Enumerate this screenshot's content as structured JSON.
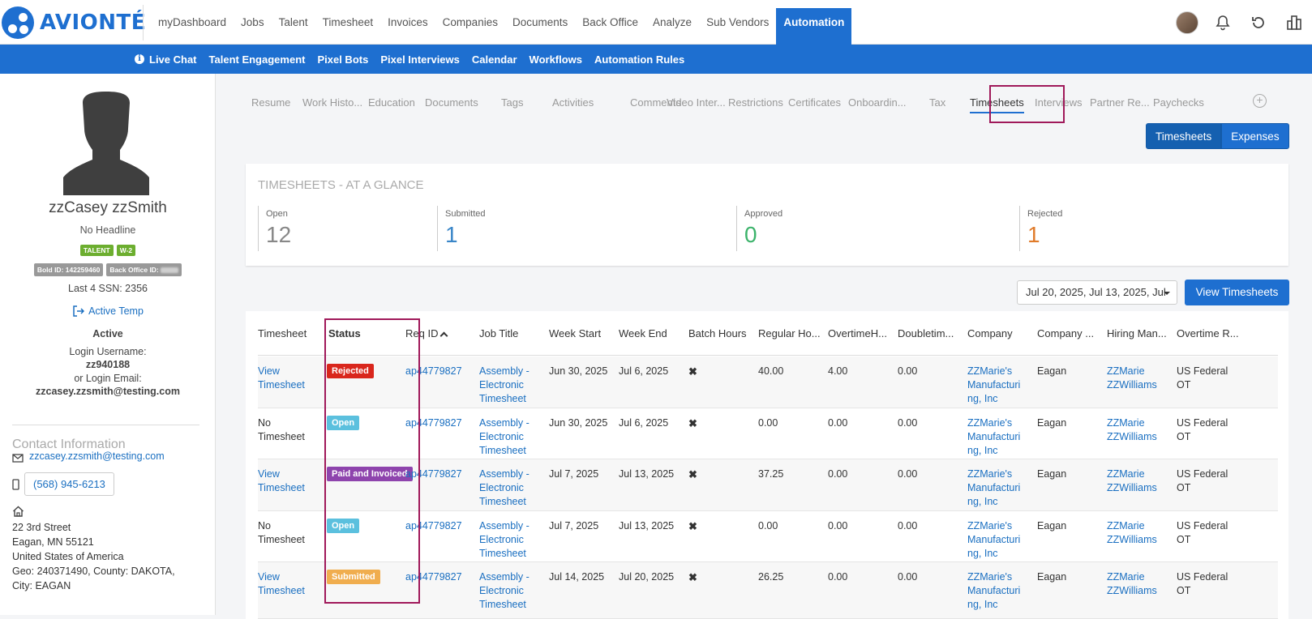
{
  "brand": {
    "name": "AVIONTÉ"
  },
  "main_nav": [
    "myDashboard",
    "Jobs",
    "Talent",
    "Timesheet",
    "Invoices",
    "Companies",
    "Documents",
    "Back Office",
    "Analyze",
    "Sub Vendors",
    "Automation"
  ],
  "main_nav_active": "Automation",
  "sub_nav": [
    "Live Chat",
    "Talent Engagement",
    "Pixel Bots",
    "Pixel Interviews",
    "Calendar",
    "Workflows",
    "Automation Rules"
  ],
  "profile": {
    "name": "zzCasey zzSmith",
    "headline": "No Headline",
    "tags": [
      "TALENT",
      "W-2"
    ],
    "bold_id": "Bold ID: 142259460",
    "back_office_id_label": "Back Office ID:",
    "ssn": "Last 4 SSN: 2356",
    "status_link": "Active Temp",
    "active": "Active",
    "login_username_label": "Login Username:",
    "login_username": "zz940188",
    "login_email_label": "or Login Email:",
    "login_email": "zzcasey.zzsmith@testing.com"
  },
  "contact": {
    "title": "Contact Information",
    "email": "zzcasey.zzsmith@testing.com",
    "phone": "(568) 945-6213",
    "address_lines": [
      "22 3rd Street",
      "Eagan, MN 55121",
      "United States of America",
      "Geo: 240371490, County: DAKOTA,",
      "City: EAGAN"
    ]
  },
  "profile_tabs": [
    "Resume",
    "Work Histo...",
    "Education",
    "Documents",
    "Tags",
    "Activities",
    "Comments",
    "Video Inter...",
    "Restrictions",
    "Certificates",
    "Onboardin...",
    "Tax",
    "Timesheets",
    "Interviews",
    "Partner Re...",
    "Paychecks"
  ],
  "profile_tab_active": "Timesheets",
  "toggle": {
    "left": "Timesheets",
    "right": "Expenses"
  },
  "glance": {
    "title": "TIMESHEETS - AT A GLANCE",
    "stats": [
      {
        "label": "Open",
        "value": "12",
        "color": "#888888"
      },
      {
        "label": "Submitted",
        "value": "1",
        "color": "#3a86c8"
      },
      {
        "label": "Approved",
        "value": "0",
        "color": "#3cb36b"
      },
      {
        "label": "Rejected",
        "value": "1",
        "color": "#e07b2a"
      }
    ]
  },
  "date_filter": {
    "value": "Jul 20, 2025, Jul 13, 2025, Jul"
  },
  "view_button": "View Timesheets",
  "table": {
    "headers": [
      "Timesheet",
      "Status",
      "Req ID",
      "Job Title",
      "Week Start",
      "Week End",
      "Batch Hours",
      "Regular Ho...",
      "OvertimeH...",
      "Doubletim...",
      "Company",
      "Company ...",
      "Hiring Man...",
      "Overtime R..."
    ],
    "rows": [
      {
        "timesheet": [
          "View",
          "Timesheet"
        ],
        "ts_link": true,
        "status": "Rejected",
        "status_color": "#d9261c",
        "req": "ap44779827",
        "job": [
          "Assembly -",
          "Electronic",
          "Timesheet"
        ],
        "start": "Jun 30, 2025",
        "end": "Jul 6, 2025",
        "batch": "✖",
        "regular": "40.00",
        "overtime": "4.00",
        "double": "0.00",
        "company": [
          "ZZMarie's",
          "Manufacturi",
          "ng, Inc"
        ],
        "city": "Eagan",
        "manager": [
          "ZZMarie",
          "ZZWilliams"
        ],
        "ot_rule": [
          "US Federal",
          "OT"
        ]
      },
      {
        "timesheet": [
          "No",
          "Timesheet"
        ],
        "ts_link": false,
        "status": "Open",
        "status_color": "#5bc0de",
        "req": "ap44779827",
        "job": [
          "Assembly -",
          "Electronic",
          "Timesheet"
        ],
        "start": "Jun 30, 2025",
        "end": "Jul 6, 2025",
        "batch": "✖",
        "regular": "0.00",
        "overtime": "0.00",
        "double": "0.00",
        "company": [
          "ZZMarie's",
          "Manufacturi",
          "ng, Inc"
        ],
        "city": "Eagan",
        "manager": [
          "ZZMarie",
          "ZZWilliams"
        ],
        "ot_rule": [
          "US Federal",
          "OT"
        ]
      },
      {
        "timesheet": [
          "View",
          "Timesheet"
        ],
        "ts_link": true,
        "status": "Paid and Invoiced",
        "status_color": "#8e44ad",
        "req": "ap44779827",
        "job": [
          "Assembly -",
          "Electronic",
          "Timesheet"
        ],
        "start": "Jul 7, 2025",
        "end": "Jul 13, 2025",
        "batch": "✖",
        "regular": "37.25",
        "overtime": "0.00",
        "double": "0.00",
        "company": [
          "ZZMarie's",
          "Manufacturi",
          "ng, Inc"
        ],
        "city": "Eagan",
        "manager": [
          "ZZMarie",
          "ZZWilliams"
        ],
        "ot_rule": [
          "US Federal",
          "OT"
        ]
      },
      {
        "timesheet": [
          "No",
          "Timesheet"
        ],
        "ts_link": false,
        "status": "Open",
        "status_color": "#5bc0de",
        "req": "ap44779827",
        "job": [
          "Assembly -",
          "Electronic",
          "Timesheet"
        ],
        "start": "Jul 7, 2025",
        "end": "Jul 13, 2025",
        "batch": "✖",
        "regular": "0.00",
        "overtime": "0.00",
        "double": "0.00",
        "company": [
          "ZZMarie's",
          "Manufacturi",
          "ng, Inc"
        ],
        "city": "Eagan",
        "manager": [
          "ZZMarie",
          "ZZWilliams"
        ],
        "ot_rule": [
          "US Federal",
          "OT"
        ]
      },
      {
        "timesheet": [
          "View",
          "Timesheet"
        ],
        "ts_link": true,
        "status": "Submitted",
        "status_color": "#f0ad4e",
        "req": "ap44779827",
        "job": [
          "Assembly -",
          "Electronic",
          "Timesheet"
        ],
        "start": "Jul 14, 2025",
        "end": "Jul 20, 2025",
        "batch": "✖",
        "regular": "26.25",
        "overtime": "0.00",
        "double": "0.00",
        "company": [
          "ZZMarie's",
          "Manufacturi",
          "ng, Inc"
        ],
        "city": "Eagan",
        "manager": [
          "ZZMarie",
          "ZZWilliams"
        ],
        "ot_rule": [
          "US Federal",
          "OT"
        ]
      }
    ]
  },
  "colors": {
    "primary": "#1e6fd0",
    "highlight_box": "#a0195a"
  }
}
